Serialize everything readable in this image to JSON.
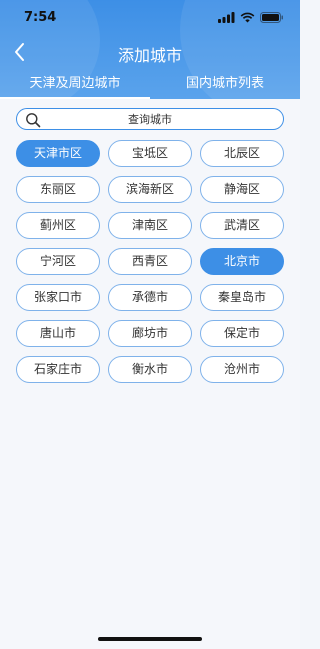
{
  "status": {
    "time": "7:54"
  },
  "nav": {
    "title": "添加城市"
  },
  "tabs": [
    {
      "label": "天津及周边城市",
      "active": true
    },
    {
      "label": "国内城市列表",
      "active": false
    }
  ],
  "search": {
    "placeholder": "查询城市"
  },
  "cities": [
    {
      "name": "天津市区",
      "selected": true
    },
    {
      "name": "宝坻区",
      "selected": false
    },
    {
      "name": "北辰区",
      "selected": false
    },
    {
      "name": "东丽区",
      "selected": false
    },
    {
      "name": "滨海新区",
      "selected": false
    },
    {
      "name": "静海区",
      "selected": false
    },
    {
      "name": "蓟州区",
      "selected": false
    },
    {
      "name": "津南区",
      "selected": false
    },
    {
      "name": "武清区",
      "selected": false
    },
    {
      "name": "宁河区",
      "selected": false
    },
    {
      "name": "西青区",
      "selected": false
    },
    {
      "name": "北京市",
      "selected": true
    },
    {
      "name": "张家口市",
      "selected": false
    },
    {
      "name": "承德市",
      "selected": false
    },
    {
      "name": "秦皇岛市",
      "selected": false
    },
    {
      "name": "唐山市",
      "selected": false
    },
    {
      "name": "廊坊市",
      "selected": false
    },
    {
      "name": "保定市",
      "selected": false
    },
    {
      "name": "石家庄市",
      "selected": false
    },
    {
      "name": "衡水市",
      "selected": false
    },
    {
      "name": "沧州市",
      "selected": false
    }
  ],
  "colors": {
    "accent": "#3d8fe6",
    "chip_border": "#7fb2ea"
  },
  "icons": [
    "back-chevron-icon",
    "search-icon",
    "signal-icon",
    "wifi-icon",
    "battery-icon"
  ]
}
